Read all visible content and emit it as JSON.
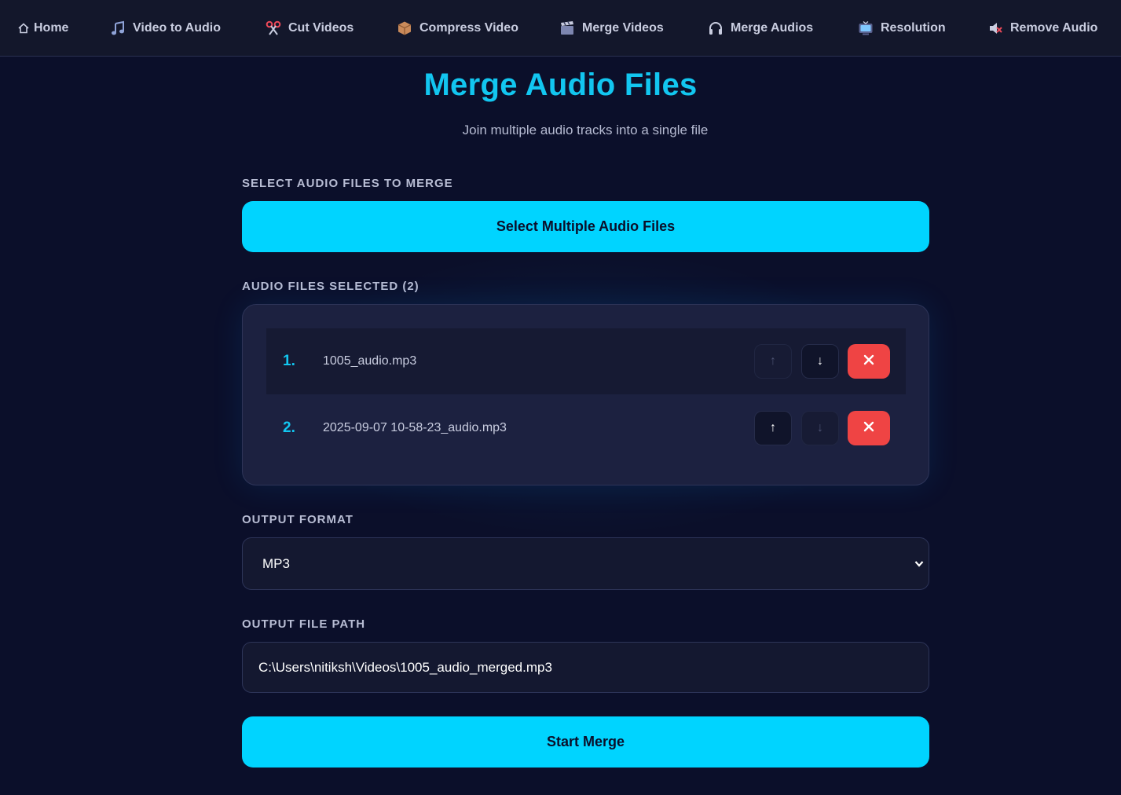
{
  "nav": {
    "items": [
      {
        "label": "Home",
        "icon": "home-icon"
      },
      {
        "label": "Video to Audio",
        "icon": "music-note-icon"
      },
      {
        "label": "Cut Videos",
        "icon": "scissors-icon"
      },
      {
        "label": "Compress Video",
        "icon": "package-icon"
      },
      {
        "label": "Merge Videos",
        "icon": "clapperboard-icon"
      },
      {
        "label": "Merge Audios",
        "icon": "headphones-icon"
      },
      {
        "label": "Resolution",
        "icon": "television-icon"
      },
      {
        "label": "Remove Audio",
        "icon": "muted-speaker-icon"
      }
    ]
  },
  "page": {
    "title": "Merge Audio Files",
    "subtitle": "Join multiple audio tracks into a single file"
  },
  "select_section": {
    "label": "SELECT AUDIO FILES TO MERGE",
    "button_label": "Select Multiple Audio Files"
  },
  "files_section": {
    "label": "AUDIO FILES SELECTED (2)",
    "files": [
      {
        "number": "1.",
        "name": "1005_audio.mp3"
      },
      {
        "number": "2.",
        "name": "2025-09-07 10-58-23_audio.mp3"
      }
    ],
    "up_glyph": "↑",
    "down_glyph": "↓",
    "remove_glyph": "✕"
  },
  "format_section": {
    "label": "OUTPUT FORMAT",
    "selected": "MP3"
  },
  "path_section": {
    "label": "OUTPUT FILE PATH",
    "value": "C:\\Users\\nitiksh\\Videos\\1005_audio_merged.mp3"
  },
  "actions": {
    "start_label": "Start Merge"
  },
  "colors": {
    "accent": "#00d4ff",
    "danger": "#ef4444",
    "background": "#0b0f2a"
  }
}
